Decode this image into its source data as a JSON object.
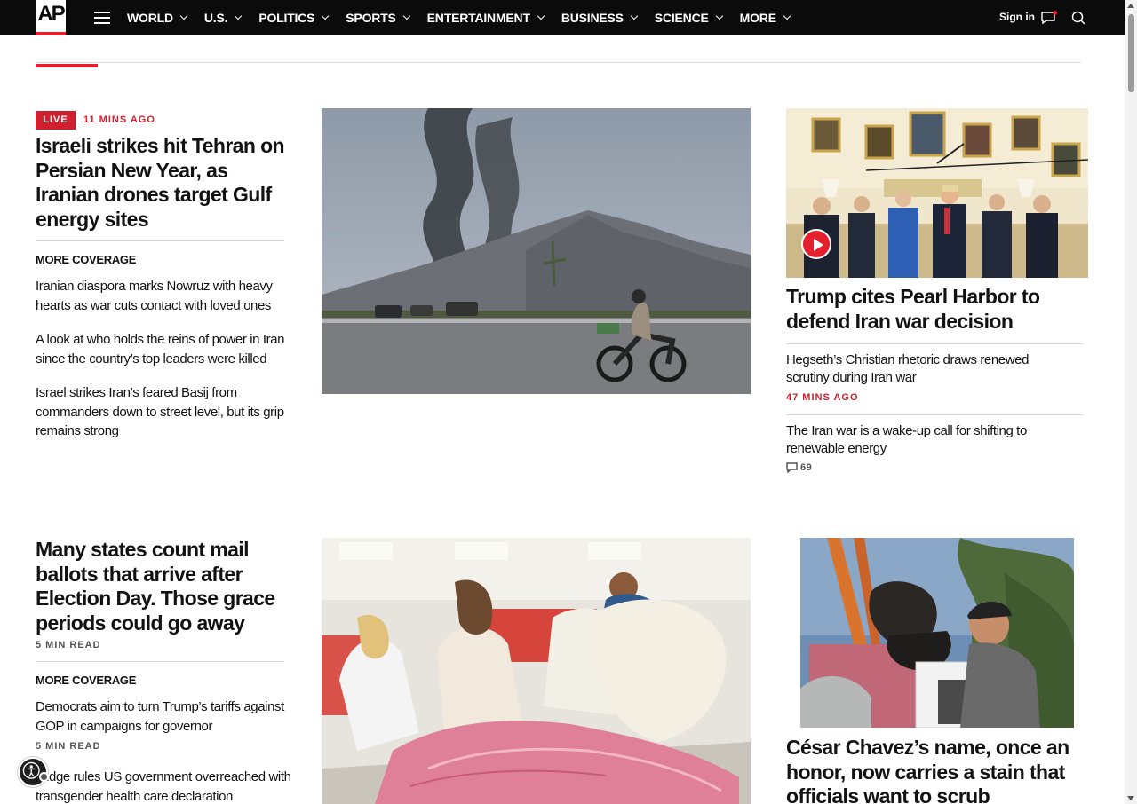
{
  "nav": {
    "logo": "AP",
    "items": [
      {
        "label": "WORLD"
      },
      {
        "label": "U.S."
      },
      {
        "label": "POLITICS"
      },
      {
        "label": "SPORTS"
      },
      {
        "label": "ENTERTAINMENT"
      },
      {
        "label": "BUSINESS"
      },
      {
        "label": "SCIENCE"
      },
      {
        "label": "MORE"
      }
    ],
    "signin": "Sign in",
    "accent_color": "#e4202e"
  },
  "lead": {
    "live_badge": "LIVE",
    "timestamp": "11 MINS AGO",
    "headline": "Israeli strikes hit Tehran on Persian New Year, as Iranian drones target Gulf energy sites",
    "more_coverage": "MORE COVERAGE",
    "related": [
      "Iranian diaspora marks Nowruz with heavy hearts as war cuts contact with loved ones",
      "A look at who holds the reins of power in Iran since the country’s top leaders were killed",
      "Israel strikes Iran’s feared Basij from commanders down to street level, but its grip remains strong"
    ]
  },
  "right_top": {
    "headline": "Trump cites Pearl Harbor to defend Iran war decision",
    "items": [
      {
        "title": "Hegseth’s Christian rhetoric draws renewed scrutiny during Iran war",
        "meta": "47 MINS AGO"
      },
      {
        "title": "The Iran war is a wake-up call for shifting to renewable energy",
        "comments": "69"
      }
    ]
  },
  "second": {
    "headline": "Many states count mail ballots that arrive after Election Day. Those grace periods could go away",
    "read_time": "5 MIN READ",
    "more_coverage": "MORE COVERAGE",
    "related": [
      {
        "title": "Democrats aim to turn Trump’s tariffs against GOP in campaigns for governor",
        "meta": "5 MIN READ"
      },
      {
        "title": "Judge rules US government overreached with transgender health care declaration"
      }
    ]
  },
  "right_bottom": {
    "headline": "César Chavez’s name, once an honor, now carries a stain that officials want to scrub"
  }
}
